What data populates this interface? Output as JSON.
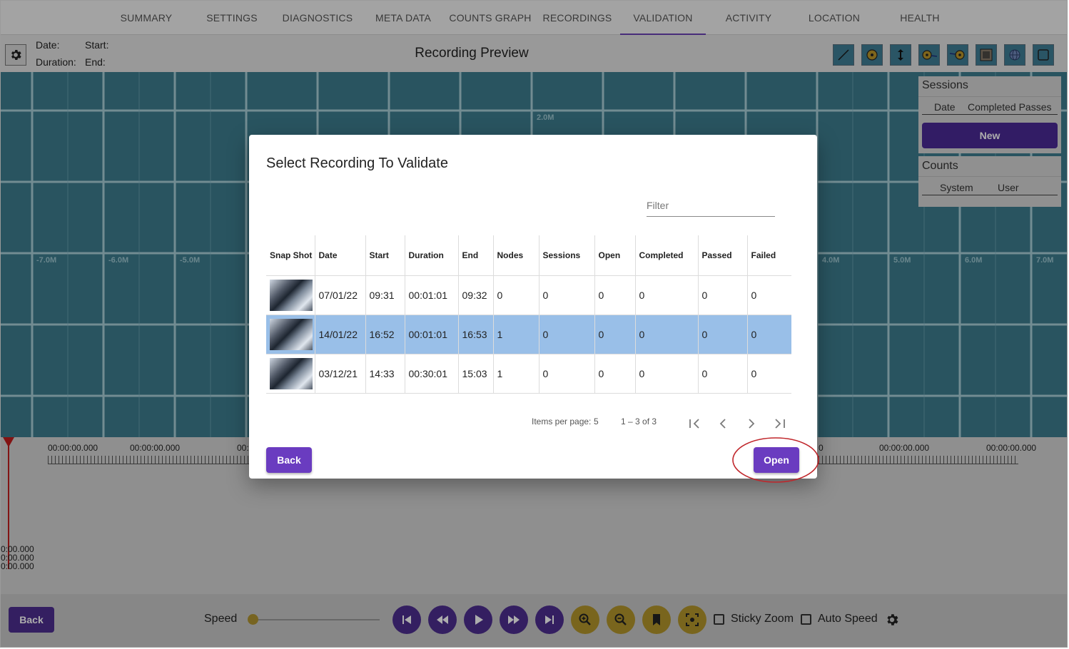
{
  "nav": {
    "tabs": [
      {
        "label": "SUMMARY"
      },
      {
        "label": "SETTINGS"
      },
      {
        "label": "DIAGNOSTICS"
      },
      {
        "label": "META DATA"
      },
      {
        "label": "COUNTS GRAPH"
      },
      {
        "label": "RECORDINGS"
      },
      {
        "label": "VALIDATION"
      },
      {
        "label": "ACTIVITY"
      },
      {
        "label": "LOCATION"
      },
      {
        "label": "HEALTH"
      }
    ],
    "active": "VALIDATION"
  },
  "header": {
    "date_label": "Date:",
    "start_label": "Start:",
    "duration_label": "Duration:",
    "end_label": "End:",
    "title": "Recording Preview",
    "tools": [
      "line-tool-icon",
      "circle-point-icon",
      "vertical-arrows-icon",
      "circle-left-line-icon",
      "circle-right-line-icon",
      "image-icon",
      "globe-icon",
      "square-icon"
    ]
  },
  "canvas": {
    "top_label": "2.0M",
    "left_labels": [
      "-7.0M",
      "-6.0M",
      "-5.0M"
    ],
    "right_labels": [
      "4.0M",
      "5.0M",
      "6.0M",
      "7.0M"
    ]
  },
  "sessions": {
    "title": "Sessions",
    "col_date": "Date",
    "col_completed": "Completed Passes",
    "new_label": "New"
  },
  "counts": {
    "title": "Counts",
    "col_system": "System",
    "col_user": "User"
  },
  "timeline": {
    "ruler_labels": [
      "00:00:00.000",
      "00:00:00.000",
      "00:",
      "0",
      "00:00:00.000",
      "00:00:00.000"
    ],
    "side_times": [
      "0:00.000",
      "0:00.000",
      "0:00.000"
    ]
  },
  "bottom": {
    "back_label": "Back",
    "speed_label": "Speed",
    "speed_value": 0,
    "sticky_zoom_label": "Sticky Zoom",
    "auto_speed_label": "Auto Speed",
    "sticky_zoom_checked": false,
    "auto_speed_checked": false
  },
  "dialog": {
    "title": "Select Recording To Validate",
    "filter_placeholder": "Filter",
    "columns": [
      "Snap Shot",
      "Date",
      "Start",
      "Duration",
      "End",
      "Nodes",
      "Sessions",
      "Open",
      "Completed",
      "Passed",
      "Failed"
    ],
    "rows": [
      {
        "date": "07/01/22",
        "start": "09:31",
        "duration": "00:01:01",
        "end": "09:32",
        "nodes": "0",
        "sessions": "0",
        "open": "0",
        "completed": "0",
        "passed": "0",
        "failed": "0",
        "selected": false
      },
      {
        "date": "14/01/22",
        "start": "16:52",
        "duration": "00:01:01",
        "end": "16:53",
        "nodes": "1",
        "sessions": "0",
        "open": "0",
        "completed": "0",
        "passed": "0",
        "failed": "0",
        "selected": true
      },
      {
        "date": "03/12/21",
        "start": "14:33",
        "duration": "00:30:01",
        "end": "15:03",
        "nodes": "1",
        "sessions": "0",
        "open": "0",
        "completed": "0",
        "passed": "0",
        "failed": "0",
        "selected": false
      }
    ],
    "items_per_page_label": "Items per page:",
    "items_per_page": "5",
    "range_label": "1 – 3 of 3",
    "back_label": "Back",
    "open_label": "Open"
  },
  "colors": {
    "primary": "#6a3cc0",
    "selected_row": "#99bfe8",
    "highlight_ring": "#c0262b",
    "canvas": "#5fb3c9",
    "accent_yellow": "#f5c842"
  }
}
